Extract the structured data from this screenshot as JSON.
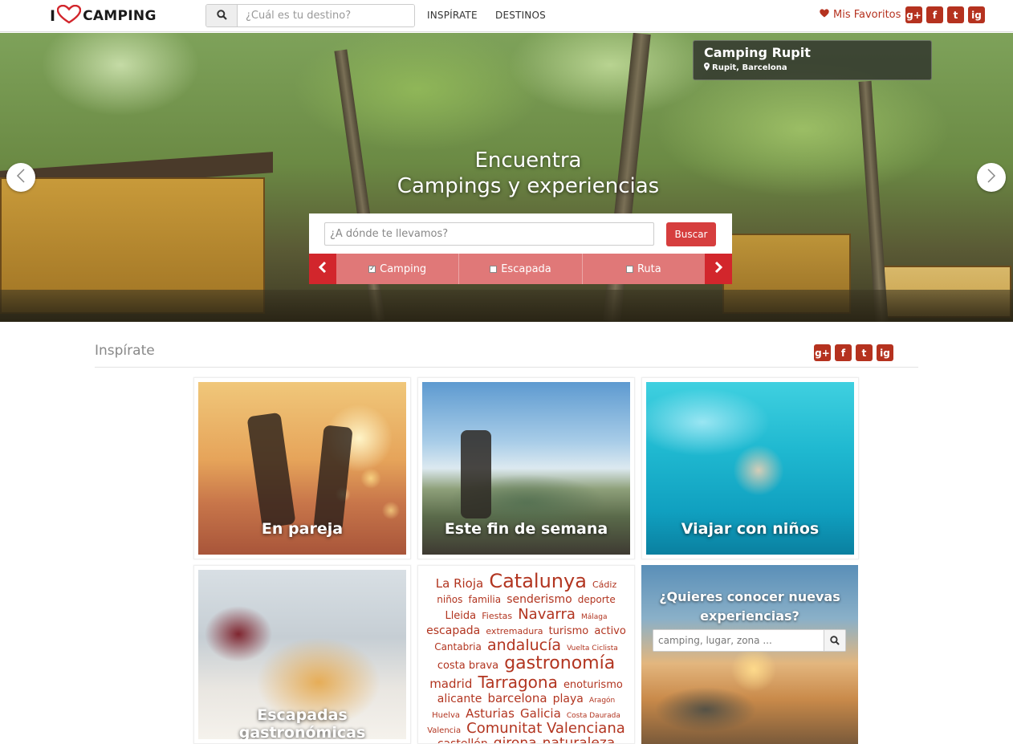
{
  "navbar": {
    "logo_i": "I",
    "logo_word": "CAMPING",
    "search_placeholder": "¿Cuál es tu destino?",
    "links": [
      "INSPÍRATE",
      "DESTINOS"
    ],
    "favorites_label": "Mis Favoritos",
    "social": [
      "g+",
      "f",
      "t",
      "ig"
    ]
  },
  "hero": {
    "place_name": "Camping Rupit",
    "place_location": "Rupit, Barcelona",
    "title_line1": "Encuentra",
    "title_line2": "Campings y experiencias",
    "search_placeholder": "¿A dónde te llevamos?",
    "search_button": "Buscar",
    "types": [
      {
        "label": "Camping",
        "checked": true
      },
      {
        "label": "Escapada",
        "checked": false
      },
      {
        "label": "Ruta",
        "checked": false
      }
    ]
  },
  "inspirate": {
    "title": "Inspírate",
    "tiles": {
      "pareja": "En pareja",
      "fin_semana": "Este fin de semana",
      "ninos": "Viajar con niños",
      "gastro": "Escapadas gastronómicas"
    },
    "tag_cloud": [
      {
        "text": "La Rioja",
        "size": 15
      },
      {
        "text": "Catalunya",
        "size": 24
      },
      {
        "text": "Cádiz",
        "size": 11
      },
      {
        "text": "niños",
        "size": 12
      },
      {
        "text": "familia",
        "size": 12
      },
      {
        "text": "senderismo",
        "size": 14
      },
      {
        "text": "deporte",
        "size": 12
      },
      {
        "text": "Lleida",
        "size": 13
      },
      {
        "text": "Fiestas",
        "size": 11
      },
      {
        "text": "Navarra",
        "size": 18
      },
      {
        "text": "Málaga",
        "size": 9
      },
      {
        "text": "escapada",
        "size": 14
      },
      {
        "text": "extremadura",
        "size": 11
      },
      {
        "text": "turismo",
        "size": 13
      },
      {
        "text": "activo",
        "size": 13
      },
      {
        "text": "Cantabria",
        "size": 12
      },
      {
        "text": "andalucía",
        "size": 19
      },
      {
        "text": "Vuelta Ciclista",
        "size": 9
      },
      {
        "text": "costa brava",
        "size": 13
      },
      {
        "text": "gastronomía",
        "size": 22
      },
      {
        "text": "madrid",
        "size": 15
      },
      {
        "text": "Tarragona",
        "size": 20
      },
      {
        "text": "enoturismo",
        "size": 13
      },
      {
        "text": "alicante",
        "size": 14
      },
      {
        "text": "barcelona",
        "size": 15
      },
      {
        "text": "playa",
        "size": 14
      },
      {
        "text": "Aragón",
        "size": 9
      },
      {
        "text": "Huelva",
        "size": 10
      },
      {
        "text": "Asturias",
        "size": 15
      },
      {
        "text": "Galicia",
        "size": 15
      },
      {
        "text": "Costa Daurada",
        "size": 9
      },
      {
        "text": "Valencia",
        "size": 10
      },
      {
        "text": "Comunitat Valenciana",
        "size": 18
      },
      {
        "text": "castellón",
        "size": 14
      },
      {
        "text": "girona",
        "size": 17
      },
      {
        "text": "naturaleza",
        "size": 17
      }
    ],
    "experiences": {
      "question": "¿Quieres conocer nuevas experiencias?",
      "search_placeholder": "camping, lugar, zona ..."
    }
  },
  "colors": {
    "accent": "#b5321f",
    "hero_red": "#d2262c",
    "hero_bar": "#e07878",
    "button": "#d63e3e"
  }
}
